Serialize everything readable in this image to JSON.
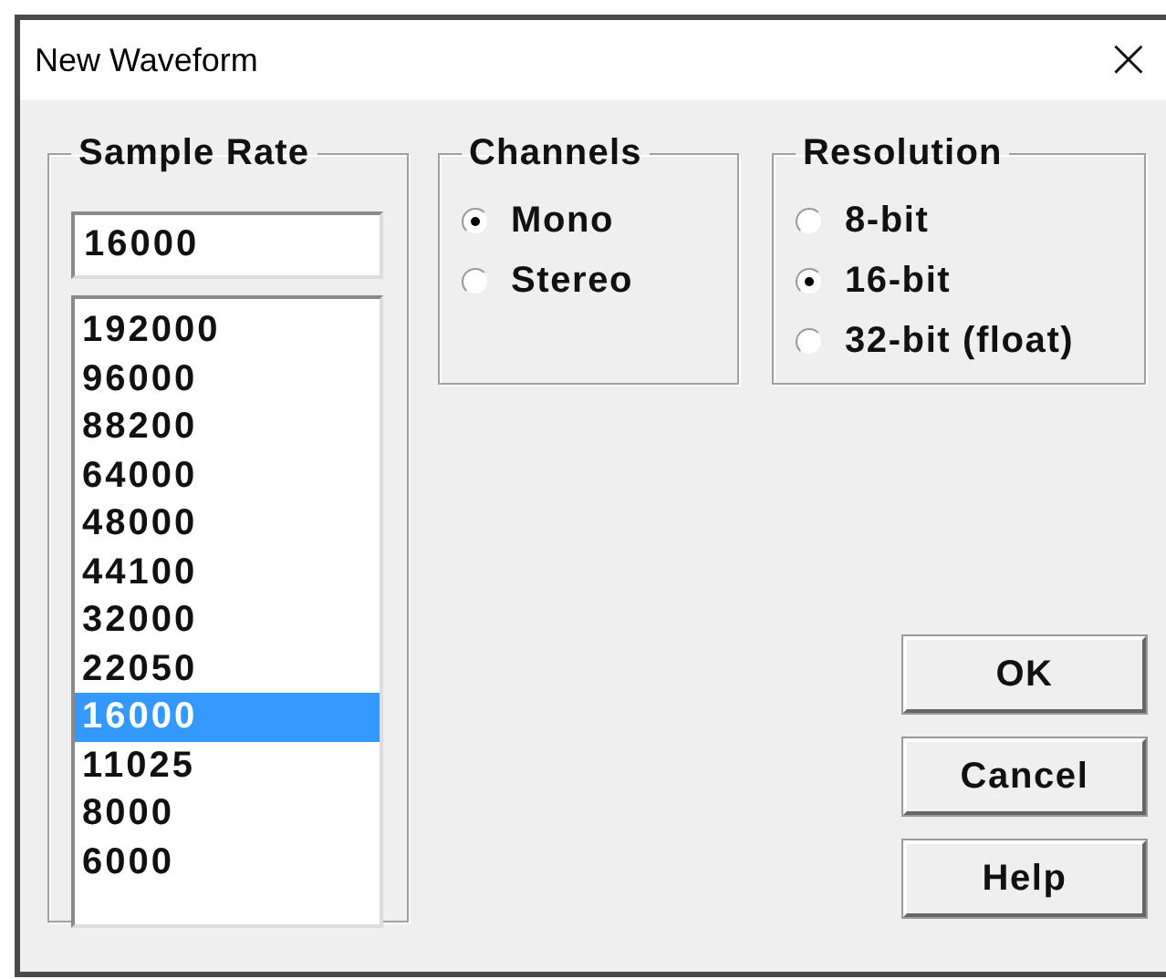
{
  "window": {
    "title": "New Waveform",
    "close": "×"
  },
  "sample_rate": {
    "legend": "Sample Rate",
    "value": "16000",
    "options": [
      {
        "label": "192000",
        "selected": false
      },
      {
        "label": "96000",
        "selected": false
      },
      {
        "label": "88200",
        "selected": false
      },
      {
        "label": "64000",
        "selected": false
      },
      {
        "label": "48000",
        "selected": false
      },
      {
        "label": "44100",
        "selected": false
      },
      {
        "label": "32000",
        "selected": false
      },
      {
        "label": "22050",
        "selected": false
      },
      {
        "label": "16000",
        "selected": true
      },
      {
        "label": "11025",
        "selected": false
      },
      {
        "label": "8000",
        "selected": false
      },
      {
        "label": "6000",
        "selected": false
      }
    ]
  },
  "channels": {
    "legend": "Channels",
    "options": [
      {
        "label": "Mono",
        "selected": true
      },
      {
        "label": "Stereo",
        "selected": false
      }
    ]
  },
  "resolution": {
    "legend": "Resolution",
    "options": [
      {
        "label": "8-bit",
        "selected": false
      },
      {
        "label": "16-bit",
        "selected": true
      },
      {
        "label": "32-bit (float)",
        "selected": false
      }
    ]
  },
  "buttons": [
    "OK",
    "Cancel",
    "Help"
  ]
}
